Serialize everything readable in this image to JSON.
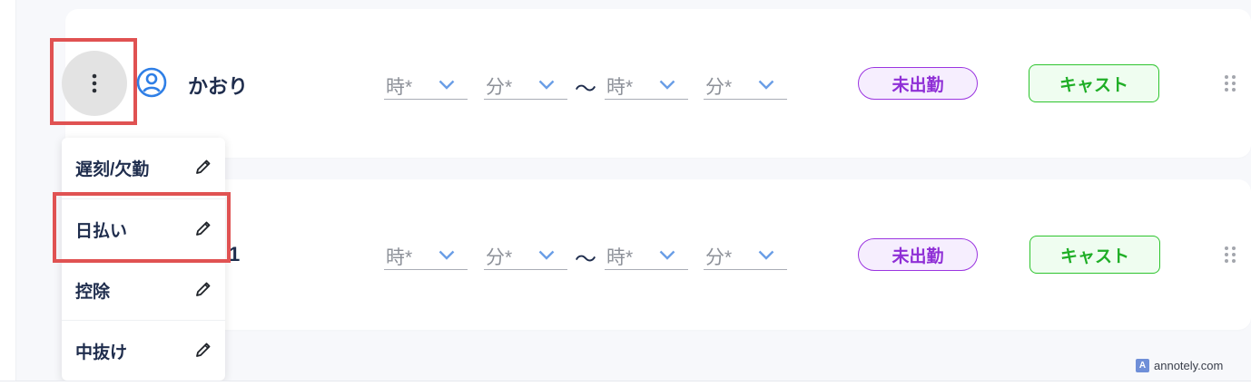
{
  "rows": [
    {
      "name": "かおり",
      "start_hour_placeholder": "時*",
      "start_min_placeholder": "分*",
      "end_hour_placeholder": "時*",
      "end_min_placeholder": "分*",
      "range_separator": "〜",
      "status": "未出勤",
      "role": "キャスト"
    },
    {
      "name_fragment": "1",
      "start_hour_placeholder": "時*",
      "start_min_placeholder": "分*",
      "end_hour_placeholder": "時*",
      "end_min_placeholder": "分*",
      "range_separator": "〜",
      "status": "未出勤",
      "role": "キャスト"
    }
  ],
  "menu": {
    "items": [
      {
        "label": "遅刻/欠勤",
        "icon": "pencil-icon"
      },
      {
        "label": "日払い",
        "icon": "pencil-icon"
      },
      {
        "label": "控除",
        "icon": "pencil-icon"
      },
      {
        "label": "中抜け",
        "icon": "pencil-icon"
      }
    ]
  },
  "icons": {
    "kebab": "kebab-menu-icon",
    "user": "user-icon",
    "dropdown": "chevron-down-icon",
    "drag": "drag-handle-icon"
  },
  "colors": {
    "highlight": "#e05252",
    "status_purple": "#9b35e0",
    "role_green": "#2ec42e",
    "chevron_blue": "#6a9ee6",
    "user_icon_blue": "#2f7fe6"
  },
  "watermark": "annotely.com"
}
